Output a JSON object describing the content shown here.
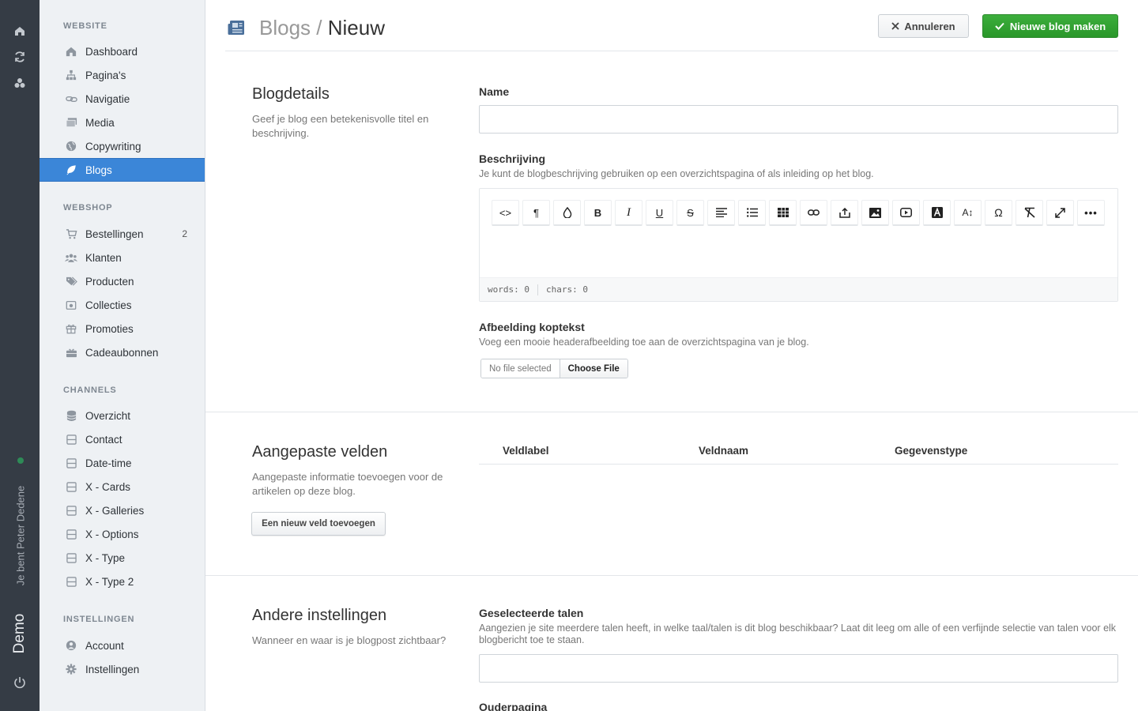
{
  "rail": {
    "user_text": "Je bent Peter Dedene",
    "site_name": "Demo",
    "status_color": "#2e8b57"
  },
  "sidebar": {
    "sections": {
      "website": "WEBSITE",
      "webshop": "WEBSHOP",
      "channels": "CHANNELS",
      "settings": "INSTELLINGEN"
    },
    "website_items": [
      {
        "label": "Dashboard",
        "icon": "home-icon"
      },
      {
        "label": "Pagina's",
        "icon": "sitemap-icon"
      },
      {
        "label": "Navigatie",
        "icon": "link-icon"
      },
      {
        "label": "Media",
        "icon": "images-icon"
      },
      {
        "label": "Copywriting",
        "icon": "globe-icon"
      },
      {
        "label": "Blogs",
        "icon": "feather-icon",
        "active": true
      }
    ],
    "webshop_items": [
      {
        "label": "Bestellingen",
        "icon": "cart-icon",
        "badge": "2"
      },
      {
        "label": "Klanten",
        "icon": "users-icon"
      },
      {
        "label": "Producten",
        "icon": "tags-icon"
      },
      {
        "label": "Collecties",
        "icon": "collection-icon"
      },
      {
        "label": "Promoties",
        "icon": "gift-icon"
      },
      {
        "label": "Cadeaubonnen",
        "icon": "giftcard-icon"
      }
    ],
    "channel_items": [
      {
        "label": "Overzicht",
        "icon": "database-icon"
      },
      {
        "label": "Contact",
        "icon": "channel-icon"
      },
      {
        "label": "Date-time",
        "icon": "channel-icon"
      },
      {
        "label": "X - Cards",
        "icon": "channel-icon"
      },
      {
        "label": "X - Galleries",
        "icon": "channel-icon"
      },
      {
        "label": "X - Options",
        "icon": "channel-icon"
      },
      {
        "label": "X - Type",
        "icon": "channel-icon"
      },
      {
        "label": "X - Type 2",
        "icon": "channel-icon"
      }
    ],
    "settings_items": [
      {
        "label": "Account",
        "icon": "user-circle-icon"
      },
      {
        "label": "Instellingen",
        "icon": "gear-icon"
      }
    ]
  },
  "header": {
    "breadcrumb_parent": "Blogs /",
    "breadcrumb_current": "Nieuw",
    "cancel_label": "Annuleren",
    "create_label": "Nieuwe blog maken"
  },
  "details": {
    "title": "Blogdetails",
    "description": "Geef je blog een betekenisvolle titel en beschrijving.",
    "name_label": "Name",
    "name_value": "",
    "desc_label": "Beschrijving",
    "desc_help": "Je kunt de blogbeschrijving gebruiken op een overzichtspagina of als inleiding op het blog.",
    "editor_words": "words: 0",
    "editor_chars": "chars: 0",
    "image_label": "Afbeelding koptekst",
    "image_help": "Voeg een mooie headerafbeelding toe aan de overzichtspagina van je blog.",
    "file_status": "No file selected",
    "file_button": "Choose File"
  },
  "custom_fields": {
    "title": "Aangepaste velden",
    "description": "Aangepaste informatie toevoegen voor de artikelen op deze blog.",
    "add_button": "Een nieuw veld toevoegen",
    "columns": [
      "Veldlabel",
      "Veldnaam",
      "Gegevenstype"
    ]
  },
  "other_settings": {
    "title": "Andere instellingen",
    "description": "Wanneer en waar is je blogpost zichtbaar?",
    "languages_label": "Geselecteerde talen",
    "languages_help": "Aangezien je site meerdere talen heeft, in welke taal/talen is dit blog beschikbaar? Laat dit leeg om alle of een verfijnde selectie van talen voor elk blogbericht toe te staan.",
    "parent_label": "Ouderpagina"
  },
  "colors": {
    "rail": "#353c45",
    "sidebar": "#eef1f4",
    "active": "#3b86d8",
    "primary": "#2e9e2e"
  }
}
